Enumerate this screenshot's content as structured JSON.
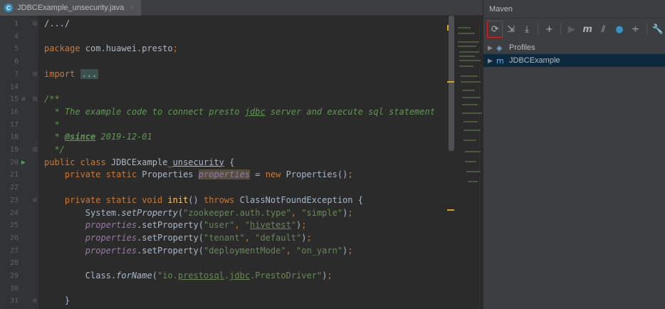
{
  "tab": {
    "icon": "java-class-icon",
    "label": "JDBCExample_unsecurity.java",
    "close": "×"
  },
  "editor": {
    "lines": [
      {
        "n": "1",
        "fold": "⊟",
        "segments": [
          [
            "cls",
            "/.../"
          ]
        ]
      },
      {
        "n": "4",
        "segments": []
      },
      {
        "n": "5",
        "segments": [
          [
            "kw",
            "package "
          ],
          [
            "cls",
            "com.huawei.presto"
          ],
          [
            "kw",
            ";"
          ]
        ]
      },
      {
        "n": "6",
        "segments": []
      },
      {
        "n": "7",
        "fold": "⊟",
        "segments": [
          [
            "kw",
            "import "
          ],
          [
            "folded",
            "..."
          ]
        ]
      },
      {
        "n": "14",
        "segments": []
      },
      {
        "n": "15",
        "marker": "≡",
        "fold": "⊟",
        "segments": [
          [
            "cmt",
            "/**"
          ]
        ]
      },
      {
        "n": "16",
        "segments": [
          [
            "cmt",
            "  * The example code to connect presto "
          ],
          [
            "tagplain",
            "jdbc"
          ],
          [
            "cmt",
            " server and execute sql statement"
          ]
        ]
      },
      {
        "n": "17",
        "segments": [
          [
            "cmt",
            "  *"
          ]
        ]
      },
      {
        "n": "18",
        "segments": [
          [
            "cmt",
            "  * "
          ],
          [
            "tag",
            "@since"
          ],
          [
            "cmt",
            " 2019-12-01"
          ]
        ]
      },
      {
        "n": "19",
        "fold": "⊟",
        "segments": [
          [
            "cmt",
            "  */"
          ]
        ]
      },
      {
        "n": "20",
        "marker": "▶",
        "segments": [
          [
            "kw",
            "public class "
          ],
          [
            "cls",
            "JDBCExample_"
          ],
          [
            "u2",
            "unsecurity"
          ],
          [
            "cls",
            " {"
          ]
        ]
      },
      {
        "n": "21",
        "segments": [
          [
            "kw",
            "    private static "
          ],
          [
            "cls",
            "Properties "
          ],
          [
            "fldhl",
            "properties"
          ],
          [
            "cls",
            " = "
          ],
          [
            "kw",
            "new "
          ],
          [
            "cls",
            "Properties()"
          ],
          [
            "kw",
            ";"
          ]
        ]
      },
      {
        "n": "22",
        "segments": []
      },
      {
        "n": "23",
        "fold": "⊖",
        "segments": [
          [
            "kw",
            "    private static void "
          ],
          [
            "mth",
            "init"
          ],
          [
            "cls",
            "() "
          ],
          [
            "kw",
            "throws "
          ],
          [
            "cls",
            "ClassNotFoundException {"
          ]
        ]
      },
      {
        "n": "24",
        "segments": [
          [
            "cls",
            "        System."
          ],
          [
            "ital",
            "setProperty"
          ],
          [
            "cls",
            "("
          ],
          [
            "str",
            "\"zookeeper.auth.type\""
          ],
          [
            "kw",
            ", "
          ],
          [
            "str",
            "\"simple\""
          ],
          [
            "cls",
            ")"
          ],
          [
            "kw",
            ";"
          ]
        ]
      },
      {
        "n": "25",
        "segments": [
          [
            "fld",
            "        properties"
          ],
          [
            "cls",
            ".setProperty("
          ],
          [
            "str",
            "\"user\""
          ],
          [
            "kw",
            ", "
          ],
          [
            "str",
            "\""
          ],
          [
            "strund",
            "hivetest"
          ],
          [
            "str",
            "\""
          ],
          [
            "cls",
            ")"
          ],
          [
            "kw",
            ";"
          ]
        ]
      },
      {
        "n": "26",
        "segments": [
          [
            "fld",
            "        properties"
          ],
          [
            "cls",
            ".setProperty("
          ],
          [
            "str",
            "\"tenant\""
          ],
          [
            "kw",
            ", "
          ],
          [
            "str",
            "\"default\""
          ],
          [
            "cls",
            ")"
          ],
          [
            "kw",
            ";"
          ]
        ]
      },
      {
        "n": "27",
        "segments": [
          [
            "fld",
            "        properties"
          ],
          [
            "cls",
            ".setProperty("
          ],
          [
            "str",
            "\"deploymentMode\""
          ],
          [
            "kw",
            ", "
          ],
          [
            "str",
            "\"on_yarn\""
          ],
          [
            "cls",
            ")"
          ],
          [
            "kw",
            ";"
          ]
        ]
      },
      {
        "n": "28",
        "segments": []
      },
      {
        "n": "29",
        "segments": [
          [
            "cls",
            "        Class."
          ],
          [
            "ital",
            "forName"
          ],
          [
            "cls",
            "("
          ],
          [
            "str",
            "\"io."
          ],
          [
            "strund",
            "prestosql"
          ],
          [
            "str",
            "."
          ],
          [
            "strund",
            "jdbc"
          ],
          [
            "str",
            ".PrestoDriver\""
          ],
          [
            "cls",
            ")"
          ],
          [
            "kw",
            ";"
          ]
        ]
      },
      {
        "n": "30",
        "segments": []
      },
      {
        "n": "31",
        "fold": "⊖",
        "segments": [
          [
            "cls",
            "    }"
          ]
        ]
      }
    ]
  },
  "maven": {
    "title": "Maven",
    "toolbar": [
      {
        "name": "reload-icon",
        "glyph": "⟳",
        "active": true
      },
      {
        "name": "generate-sources-icon",
        "glyph": "⇲"
      },
      {
        "name": "download-icon",
        "glyph": "⤓"
      },
      {
        "name": "add-icon",
        "glyph": "+"
      },
      {
        "name": "run-icon",
        "glyph": "▶",
        "dim": true
      },
      {
        "name": "maven-goal-icon",
        "glyph": "m"
      },
      {
        "name": "toggle-offline-icon",
        "glyph": "⫽"
      },
      {
        "name": "skip-tests-icon",
        "glyph": "●"
      },
      {
        "name": "show-dependencies-icon",
        "glyph": "÷"
      },
      {
        "name": "settings-wrench-icon",
        "glyph": "🔧"
      }
    ],
    "tree": [
      {
        "label": "Profiles",
        "icon": "profiles-icon",
        "selected": false
      },
      {
        "label": "JDBCExample",
        "icon": "maven-project-icon",
        "selected": true
      }
    ]
  },
  "colors": {
    "accent_selection": "#0d293e",
    "warning": "#d6a31b",
    "toolbar_highlight": "#e02020"
  }
}
